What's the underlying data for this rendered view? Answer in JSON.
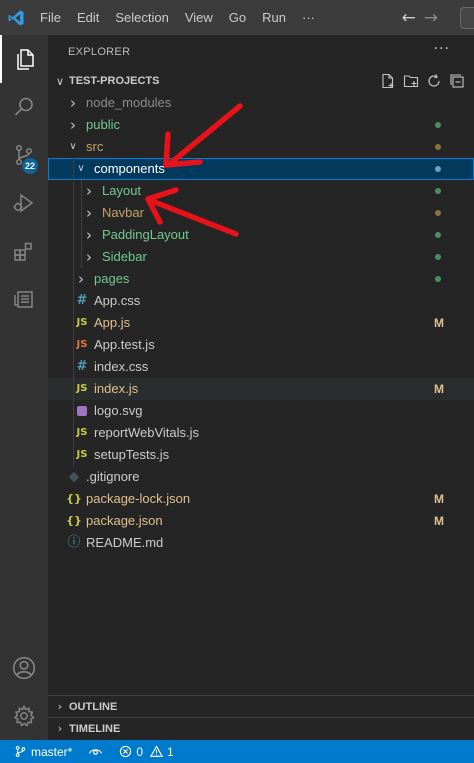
{
  "menu": {
    "items": [
      "File",
      "Edit",
      "Selection",
      "View",
      "Go",
      "Run",
      "···"
    ]
  },
  "nav": {
    "back": "←",
    "forward": "→"
  },
  "activity": {
    "scm_badge": "22"
  },
  "explorer": {
    "title": "EXPLORER",
    "more": "···",
    "project_label": "TEST-PROJECTS",
    "tree": [
      {
        "label": "node_modules",
        "kind": "folder",
        "depth": 0,
        "expanded": false,
        "color": "#8c8c8c"
      },
      {
        "label": "public",
        "kind": "folder",
        "depth": 0,
        "expanded": false,
        "color": "#73c991",
        "dot": "#4b8f63"
      },
      {
        "label": "src",
        "kind": "folder",
        "depth": 0,
        "expanded": true,
        "color": "#c5a464",
        "dot": "#8a7440"
      },
      {
        "label": "components",
        "kind": "folder",
        "depth": 1,
        "expanded": true,
        "color": "#ffffff",
        "dot": "#6f9ec0",
        "selected": true
      },
      {
        "label": "Layout",
        "kind": "folder",
        "depth": 2,
        "expanded": false,
        "color": "#73c991",
        "dot": "#4b8f63"
      },
      {
        "label": "Navbar",
        "kind": "folder",
        "depth": 2,
        "expanded": false,
        "color": "#c5a464",
        "dot": "#8a7440"
      },
      {
        "label": "PaddingLayout",
        "kind": "folder",
        "depth": 2,
        "expanded": false,
        "color": "#73c991",
        "dot": "#4b8f63"
      },
      {
        "label": "Sidebar",
        "kind": "folder",
        "depth": 2,
        "expanded": false,
        "color": "#73c991",
        "dot": "#4b8f63"
      },
      {
        "label": "pages",
        "kind": "folder",
        "depth": 1,
        "expanded": false,
        "color": "#73c991",
        "dot": "#4b8f63"
      },
      {
        "label": "App.css",
        "kind": "file",
        "icon": "#",
        "iconColor": "#519aba",
        "depth": 1,
        "color": "#cccccc"
      },
      {
        "label": "App.js",
        "kind": "file",
        "icon": "JS",
        "iconColor": "#cbcb41",
        "depth": 1,
        "color": "#e2c08d",
        "deco": "M"
      },
      {
        "label": "App.test.js",
        "kind": "file",
        "icon": "JS",
        "iconColor": "#e37933",
        "depth": 1,
        "color": "#cccccc"
      },
      {
        "label": "index.css",
        "kind": "file",
        "icon": "#",
        "iconColor": "#519aba",
        "depth": 1,
        "color": "#cccccc"
      },
      {
        "label": "index.js",
        "kind": "file",
        "icon": "JS",
        "iconColor": "#cbcb41",
        "depth": 1,
        "color": "#e2c08d",
        "deco": "M",
        "hover": true
      },
      {
        "label": "logo.svg",
        "kind": "file",
        "icon": "svg",
        "iconColor": "#a074c4",
        "depth": 1,
        "color": "#cccccc"
      },
      {
        "label": "reportWebVitals.js",
        "kind": "file",
        "icon": "JS",
        "iconColor": "#cbcb41",
        "depth": 1,
        "color": "#cccccc"
      },
      {
        "label": "setupTests.js",
        "kind": "file",
        "icon": "JS",
        "iconColor": "#cbcb41",
        "depth": 1,
        "color": "#cccccc"
      },
      {
        "label": ".gitignore",
        "kind": "file",
        "icon": "git",
        "iconColor": "#41535b",
        "depth": 0,
        "color": "#cccccc"
      },
      {
        "label": "package-lock.json",
        "kind": "file",
        "icon": "{}",
        "iconColor": "#cbcb41",
        "depth": 0,
        "color": "#e2c08d",
        "deco": "M"
      },
      {
        "label": "package.json",
        "kind": "file",
        "icon": "{}",
        "iconColor": "#cbcb41",
        "depth": 0,
        "color": "#e2c08d",
        "deco": "M"
      },
      {
        "label": "README.md",
        "kind": "file",
        "icon": "ⓘ",
        "iconColor": "#519aba",
        "depth": 0,
        "color": "#cccccc"
      }
    ]
  },
  "panels": {
    "outline": "OUTLINE",
    "timeline": "TIMELINE"
  },
  "status": {
    "branch": "master*",
    "errors": "0",
    "warnings": "1"
  },
  "colors": {
    "accent": "#007acc",
    "annotation": "#e8121a",
    "selection": "#04395e"
  }
}
